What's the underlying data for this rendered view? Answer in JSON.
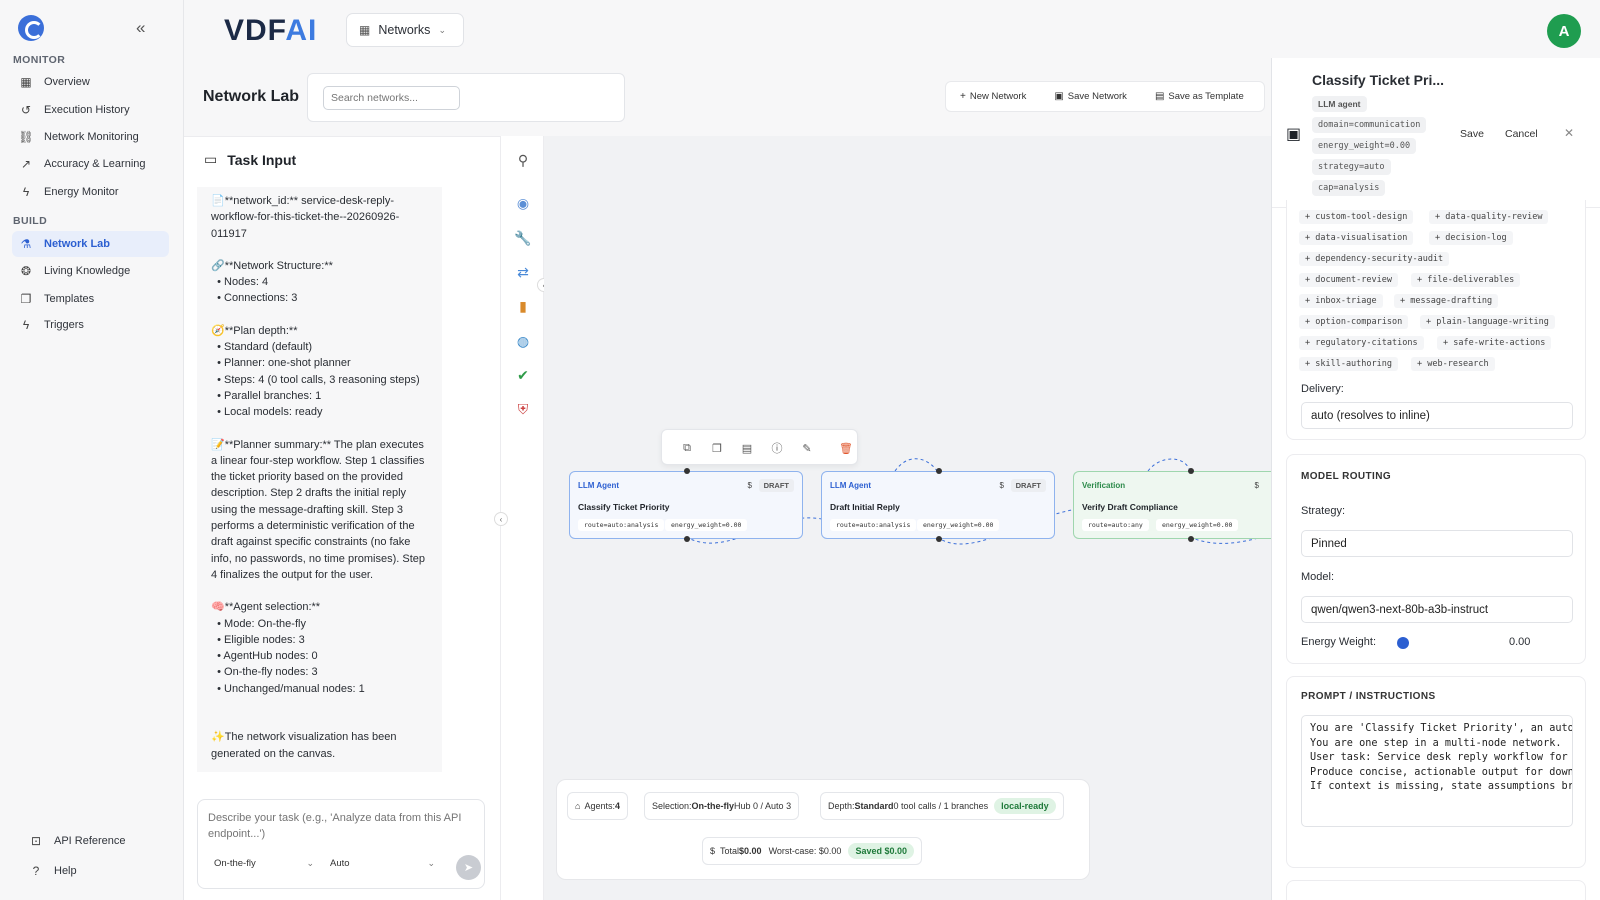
{
  "brand": {
    "part1": "VDF",
    "part2": "AI"
  },
  "network_selector": {
    "label": "Networks"
  },
  "avatar": {
    "initial": "A"
  },
  "sidebar": {
    "monitor_heading": "MONITOR",
    "build_heading": "BUILD",
    "monitor": [
      {
        "label": "Overview",
        "icon": "grid-icon"
      },
      {
        "label": "Execution History",
        "icon": "history-icon"
      },
      {
        "label": "Network Monitoring",
        "icon": "network-icon"
      },
      {
        "label": "Accuracy & Learning",
        "icon": "trend-icon"
      },
      {
        "label": "Energy Monitor",
        "icon": "bolt-icon"
      }
    ],
    "build": [
      {
        "label": "Network Lab",
        "icon": "flask-icon",
        "active": true
      },
      {
        "label": "Living Knowledge",
        "icon": "brain-icon"
      },
      {
        "label": "Templates",
        "icon": "copy-icon"
      },
      {
        "label": "Triggers",
        "icon": "bolt-icon"
      }
    ],
    "footer": [
      {
        "label": "API Reference",
        "icon": "api-icon"
      },
      {
        "label": "Help",
        "icon": "help-icon"
      }
    ]
  },
  "header": {
    "title": "Network Lab",
    "search_placeholder": "Search networks..."
  },
  "toolbar": {
    "new_network": "New Network",
    "save_network": "Save Network",
    "save_template": "Save as Template"
  },
  "task": {
    "heading": "Task Input",
    "paragraphs": [
      "📄**network_id:** service-desk-reply-workflow-for-this-ticket-the--20260926-011917",
      "🔗**Network Structure:**\n  • Nodes: 4\n  • Connections: 3",
      "🧭**Plan depth:**\n  • Standard (default)\n  • Planner: one-shot planner\n  • Steps: 4 (0 tool calls, 3 reasoning steps)\n  • Parallel branches: 1\n  • Local models: ready",
      "📝**Planner summary:** The plan executes a linear four-step workflow. Step 1 classifies the ticket priority based on the provided description. Step 2 drafts the initial reply using the message-drafting skill. Step 3 performs a deterministic verification of the draft against specific constraints (no fake info, no passwords, no time promises). Step 4 finalizes the output for the user.",
      "🧠**Agent selection:**\n  • Mode: On-the-fly\n  • Eligible nodes: 3\n  • AgentHub nodes: 0\n  • On-the-fly nodes: 3\n  • Unchanged/manual nodes: 1",
      "\n✨The network visualization has been generated on the canvas."
    ],
    "composer_placeholder": "Describe your task (e.g., 'Analyze data from this API endpoint...')",
    "mode": "On-the-fly",
    "model": "Auto"
  },
  "rail_icons": [
    "hierarchy-icon",
    "robot-icon",
    "wrench-icon",
    "shuffle-icon",
    "bar-chart-icon",
    "globe-icon",
    "check-icon",
    "shield-icon"
  ],
  "nodes": [
    {
      "category": "LLM Agent",
      "name": "Classify Ticket Priority",
      "badge": "DRAFT",
      "dollar": "$",
      "chips": [
        "route=auto:analysis",
        "energy_weight=0.00"
      ]
    },
    {
      "category": "LLM Agent",
      "name": "Draft Initial Reply",
      "badge": "DRAFT",
      "dollar": "$",
      "chips": [
        "route=auto:analysis",
        "energy_weight=0.00"
      ]
    },
    {
      "category": "Verification",
      "name": "Verify Draft Compliance",
      "dollar": "$",
      "chips": [
        "route=auto:any",
        "energy_weight=0.00"
      ]
    }
  ],
  "stats": {
    "agents_label": "Agents:",
    "agents_value": "4",
    "selection_label": "Selection:",
    "selection_value": "On-the-fly",
    "selection_rest": "Hub 0 / Auto 3",
    "depth_label": "Depth:",
    "depth_value": "Standard",
    "depth_rest": "0 tool calls / 1 branches",
    "local_pill": "local-ready",
    "total_label": "Total",
    "total_value": "$0.00",
    "worst": "Worst-case: $0.00",
    "saved_pill": "Saved $0.00"
  },
  "inspector": {
    "title": "Classify Ticket Pri...",
    "tags": [
      "LLM agent",
      "domain=communication",
      "energy_weight=0.00",
      "strategy=auto",
      "cap=analysis"
    ],
    "save": "Save",
    "cancel": "Cancel",
    "skills": [
      "+ custom-tool-design",
      "+ data-quality-review",
      "+ data-visualisation",
      "+ decision-log",
      "+ dependency-security-audit",
      "+ document-review",
      "+ file-deliverables",
      "+ inbox-triage",
      "+ message-drafting",
      "+ option-comparison",
      "+ plain-language-writing",
      "+ regulatory-citations",
      "+ safe-write-actions",
      "+ skill-authoring",
      "+ web-research"
    ],
    "delivery_label": "Delivery:",
    "delivery_value": "auto (resolves to inline)",
    "routing_heading": "MODEL ROUTING",
    "strategy_label": "Strategy:",
    "strategy_value": "Pinned",
    "model_label": "Model:",
    "model_value": "qwen/qwen3-next-80b-a3b-instruct",
    "energy_label": "Energy Weight:",
    "energy_value": "0.00",
    "energy_level": 0,
    "prompt_heading": "PROMPT / INSTRUCTIONS",
    "prompt_text": "You are 'Classify Ticket Priority', an auto-\nYou are one step in a multi-node network.\nUser task: Service desk reply workflow for t\nProduce concise, actionable output for downs\nIf context is missing, state assumptions bri"
  }
}
